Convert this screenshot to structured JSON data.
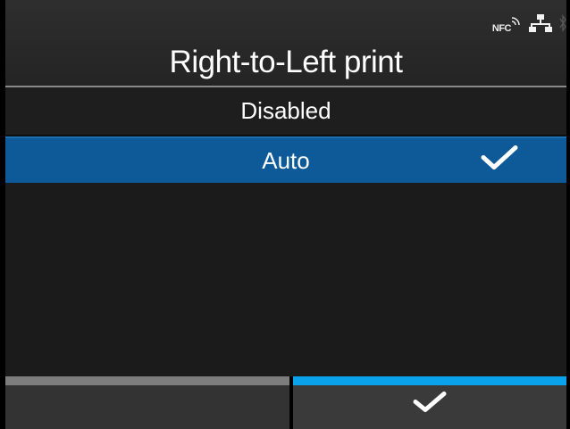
{
  "header": {
    "title": "Right-to-Left print",
    "status_icons": {
      "nfc_label": "NFC",
      "icons": [
        "nfc-icon",
        "network-icon",
        "bluetooth-icon"
      ]
    }
  },
  "options": {
    "items": [
      {
        "label": "Disabled",
        "selected": false
      },
      {
        "label": "Auto",
        "selected": true,
        "check_icon": "checkmark-icon"
      }
    ]
  },
  "footer": {
    "left_softkey": {
      "label": ""
    },
    "right_softkey": {
      "icon": "checkmark-icon",
      "accent": "#0aa2ea"
    }
  },
  "colors": {
    "selection": "#0e5a99",
    "accent": "#0aa2ea",
    "background": "#1a1a1a"
  }
}
